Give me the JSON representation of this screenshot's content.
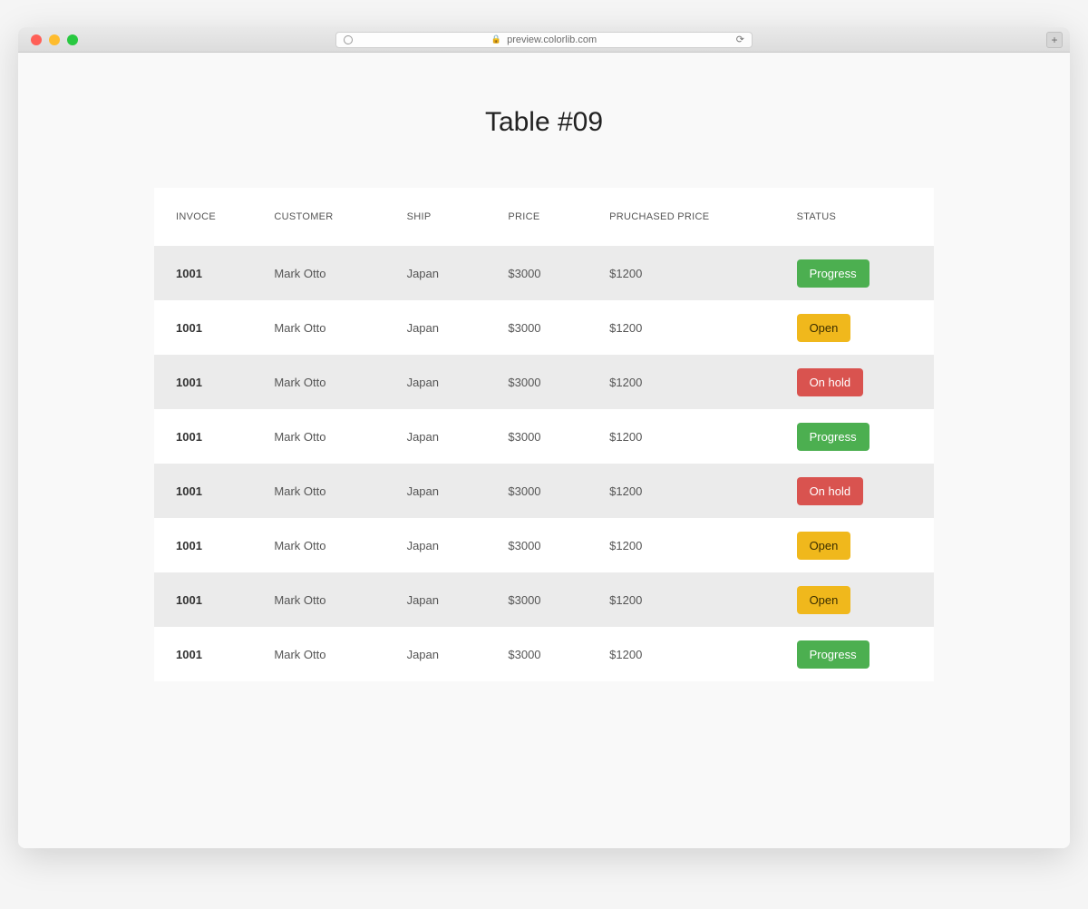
{
  "browser": {
    "url_display": "preview.colorlib.com"
  },
  "page": {
    "title": "Table #09"
  },
  "table": {
    "headers": {
      "invoice": "INVOCE",
      "customer": "CUSTOMER",
      "ship": "SHIP",
      "price": "PRICE",
      "purchased_price": "PRUCHASED PRICE",
      "status": "STATUS"
    },
    "rows": [
      {
        "invoice": "1001",
        "customer": "Mark Otto",
        "ship": "Japan",
        "price": "$3000",
        "purchased_price": "$1200",
        "status": "Progress"
      },
      {
        "invoice": "1001",
        "customer": "Mark Otto",
        "ship": "Japan",
        "price": "$3000",
        "purchased_price": "$1200",
        "status": "Open"
      },
      {
        "invoice": "1001",
        "customer": "Mark Otto",
        "ship": "Japan",
        "price": "$3000",
        "purchased_price": "$1200",
        "status": "On hold"
      },
      {
        "invoice": "1001",
        "customer": "Mark Otto",
        "ship": "Japan",
        "price": "$3000",
        "purchased_price": "$1200",
        "status": "Progress"
      },
      {
        "invoice": "1001",
        "customer": "Mark Otto",
        "ship": "Japan",
        "price": "$3000",
        "purchased_price": "$1200",
        "status": "On hold"
      },
      {
        "invoice": "1001",
        "customer": "Mark Otto",
        "ship": "Japan",
        "price": "$3000",
        "purchased_price": "$1200",
        "status": "Open"
      },
      {
        "invoice": "1001",
        "customer": "Mark Otto",
        "ship": "Japan",
        "price": "$3000",
        "purchased_price": "$1200",
        "status": "Open"
      },
      {
        "invoice": "1001",
        "customer": "Mark Otto",
        "ship": "Japan",
        "price": "$3000",
        "purchased_price": "$1200",
        "status": "Progress"
      }
    ]
  },
  "status_colors": {
    "Progress": "#4caf50",
    "Open": "#f0b81c",
    "On hold": "#d9534f"
  }
}
